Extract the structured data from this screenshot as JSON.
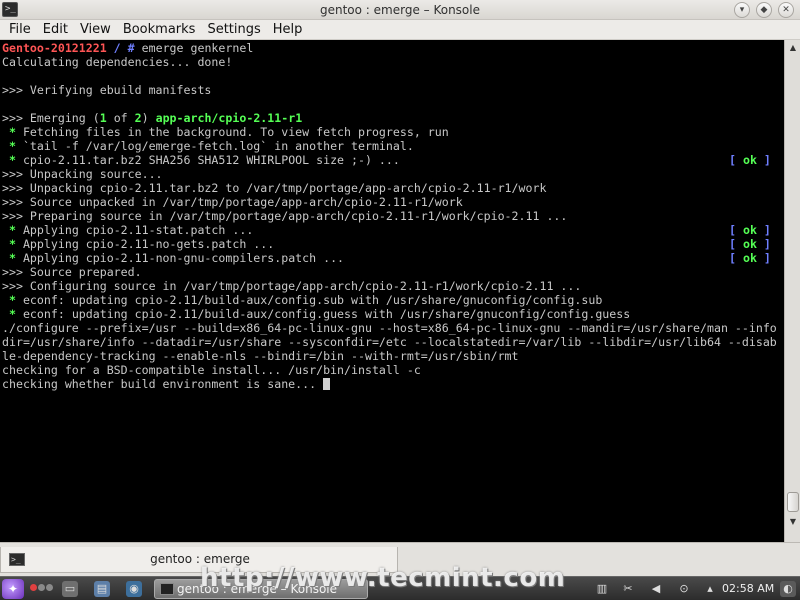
{
  "window": {
    "title": "gentoo : emerge – Konsole",
    "app_icon_glyph": ">_"
  },
  "menubar": {
    "items": [
      "File",
      "Edit",
      "View",
      "Bookmarks",
      "Settings",
      "Help"
    ]
  },
  "terminal": {
    "lines": [
      [
        {
          "t": "Gentoo-20121221",
          "c": "red"
        },
        {
          "t": " / ",
          "c": "blue"
        },
        {
          "t": "# ",
          "c": "blue"
        },
        {
          "t": "emerge genkernel",
          "c": "gray"
        }
      ],
      [
        {
          "t": "Calculating dependencies... done!",
          "c": "gray"
        }
      ],
      [],
      [
        {
          "t": ">>> Verifying ebuild manifests",
          "c": "gray"
        }
      ],
      [],
      [
        {
          "t": ">>> Emerging (",
          "c": "gray"
        },
        {
          "t": "1",
          "c": "green"
        },
        {
          "t": " of ",
          "c": "gray"
        },
        {
          "t": "2",
          "c": "green"
        },
        {
          "t": ") ",
          "c": "gray"
        },
        {
          "t": "app-arch/cpio-2.11-r1",
          "c": "green"
        }
      ],
      [
        {
          "t": " * ",
          "c": "star"
        },
        {
          "t": "Fetching files in the background. To view fetch progress, run",
          "c": "gray"
        }
      ],
      [
        {
          "t": " * ",
          "c": "star"
        },
        {
          "t": "`tail -f /var/log/emerge-fetch.log` in another terminal.",
          "c": "gray"
        }
      ],
      [
        {
          "t": " * ",
          "c": "star"
        },
        {
          "t": "cpio-2.11.tar.bz2 SHA256 SHA512 WHIRLPOOL size ;-) ...",
          "c": "gray"
        }
      ],
      [
        {
          "t": ">>> Unpacking source...",
          "c": "gray"
        }
      ],
      [
        {
          "t": ">>> Unpacking cpio-2.11.tar.bz2 to /var/tmp/portage/app-arch/cpio-2.11-r1/work",
          "c": "gray"
        }
      ],
      [
        {
          "t": ">>> Source unpacked in /var/tmp/portage/app-arch/cpio-2.11-r1/work",
          "c": "gray"
        }
      ],
      [
        {
          "t": ">>> Preparing source in /var/tmp/portage/app-arch/cpio-2.11-r1/work/cpio-2.11 ...",
          "c": "gray"
        }
      ],
      [
        {
          "t": " * ",
          "c": "star"
        },
        {
          "t": "Applying cpio-2.11-stat.patch ...",
          "c": "gray"
        }
      ],
      [
        {
          "t": " * ",
          "c": "star"
        },
        {
          "t": "Applying cpio-2.11-no-gets.patch ...",
          "c": "gray"
        }
      ],
      [
        {
          "t": " * ",
          "c": "star"
        },
        {
          "t": "Applying cpio-2.11-non-gnu-compilers.patch ...",
          "c": "gray"
        }
      ],
      [
        {
          "t": ">>> Source prepared.",
          "c": "gray"
        }
      ],
      [
        {
          "t": ">>> Configuring source in /var/tmp/portage/app-arch/cpio-2.11-r1/work/cpio-2.11 ...",
          "c": "gray"
        }
      ],
      [
        {
          "t": " * ",
          "c": "star"
        },
        {
          "t": "econf: updating cpio-2.11/build-aux/config.sub with /usr/share/gnuconfig/config.sub",
          "c": "gray"
        }
      ],
      [
        {
          "t": " * ",
          "c": "star"
        },
        {
          "t": "econf: updating cpio-2.11/build-aux/config.guess with /usr/share/gnuconfig/config.guess",
          "c": "gray"
        }
      ],
      [
        {
          "t": "./configure --prefix=/usr --build=x86_64-pc-linux-gnu --host=x86_64-pc-linux-gnu --mandir=/usr/share/man --info",
          "c": "gray"
        }
      ],
      [
        {
          "t": "dir=/usr/share/info --datadir=/usr/share --sysconfdir=/etc --localstatedir=/var/lib --libdir=/usr/lib64 --disab",
          "c": "gray"
        }
      ],
      [
        {
          "t": "le-dependency-tracking --enable-nls --bindir=/bin --with-rmt=/usr/sbin/rmt",
          "c": "gray"
        }
      ],
      [
        {
          "t": "checking for a BSD-compatible install... /usr/bin/install -c",
          "c": "gray"
        }
      ],
      [
        {
          "t": "checking whether build environment is sane... ",
          "c": "gray"
        }
      ]
    ],
    "ok_marks": [
      {
        "line": 8,
        "text": "[ ok ]"
      },
      {
        "line": 13,
        "text": "[ ok ]"
      },
      {
        "line": 14,
        "text": "[ ok ]"
      },
      {
        "line": 15,
        "text": "[ ok ]"
      }
    ],
    "cursor_line": 24
  },
  "tab": {
    "label": "gentoo : emerge"
  },
  "taskbar": {
    "task_label": "gentoo : emerge – Konsole",
    "clock": "02:58 AM"
  },
  "watermark": "http://www.tecmint.com",
  "colors": {
    "red": "#ff5555",
    "blue": "#6f7fff",
    "green": "#55ff55",
    "text": "#c8c8c8"
  }
}
